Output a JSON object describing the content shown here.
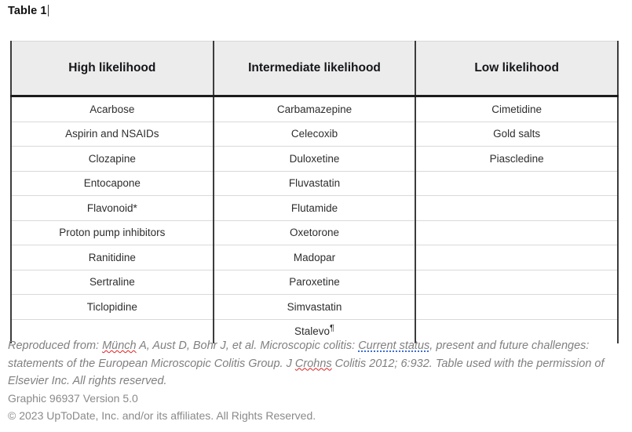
{
  "document": {
    "title": "Table 1",
    "caret_visible": true
  },
  "table": {
    "columns": [
      {
        "label": "High likelihood"
      },
      {
        "label": "Intermediate likelihood"
      },
      {
        "label": "Low likelihood"
      }
    ],
    "rows": [
      {
        "high": "Acarbose",
        "intermediate": "Carbamazepine",
        "low": "Cimetidine"
      },
      {
        "high": "Aspirin and NSAIDs",
        "intermediate": "Celecoxib",
        "low": "Gold salts"
      },
      {
        "high": "Clozapine",
        "intermediate": "Duloxetine",
        "low": "Piascledine"
      },
      {
        "high": "Entocapone",
        "intermediate": "Fluvastatin",
        "low": ""
      },
      {
        "high": "Flavonoid*",
        "intermediate": "Flutamide",
        "low": ""
      },
      {
        "high": "Proton pump inhibitors",
        "intermediate": "Oxetorone",
        "low": ""
      },
      {
        "high": "Ranitidine",
        "intermediate": "Madopar",
        "low": ""
      },
      {
        "high": "Sertraline",
        "intermediate": "Paroxetine",
        "low": ""
      },
      {
        "high": "Ticlopidine",
        "intermediate": "Simvastatin",
        "low": ""
      },
      {
        "high": "",
        "intermediate": "Stalevo",
        "intermediate_footnote": "¶",
        "low": ""
      }
    ]
  },
  "attribution": {
    "prefix": "Reproduced from: ",
    "author_flagged": "Münch",
    "authors_rest": " A, Aust D, Bohr J, et al. Microscopic colitis: ",
    "title_flagged": "Current status",
    "title_rest": ", present and future challenges: statements of the European Microscopic Colitis Group. J ",
    "journal_flagged": "Crohns",
    "journal_rest": " Colitis 2012; 6:932. Table used with the permission of Elsevier Inc. All rights reserved."
  },
  "footer": {
    "graphic_id": "Graphic 96937 Version 5.0",
    "copyright": "© 2023 UpToDate, Inc. and/or its affiliates. All Rights Reserved."
  },
  "colors": {
    "header_background": "#ececec",
    "header_rule": "#1c1c1c",
    "table_border": "#3c3c3c",
    "row_rule": "#d9d9d9",
    "caption_text": "#808080",
    "footer_text": "#8a8a8a",
    "spell_error": "#e02020",
    "grammar_error": "#3d6fd0"
  }
}
